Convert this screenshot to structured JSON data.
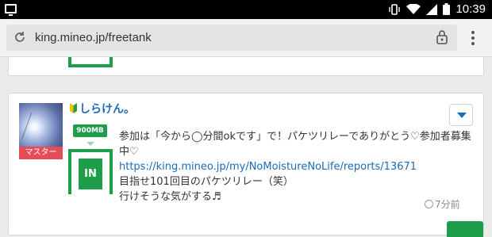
{
  "statusbar": {
    "time": "10:39"
  },
  "browser": {
    "url": "king.mineo.jp/freetank"
  },
  "post": {
    "username": "しらけん。",
    "role_badge": "マスター",
    "capacity_badge": "900MB",
    "type_badge": "IN",
    "line1": "参加は「今から◯分間okです」で！パケツリレーでありがとう♡参加者募集中♡",
    "link": "https://king.mineo.jp/my/NoMoistureNoLife/reports/13671",
    "line2": "目指せ101回目のパケツリレー（笑）",
    "line3": "行けそうな気がする♬",
    "time_ago": "7分前"
  },
  "colors": {
    "accent_green": "#1e9e4a",
    "link_blue": "#1a6bb8",
    "master_red": "#e74c5b"
  }
}
